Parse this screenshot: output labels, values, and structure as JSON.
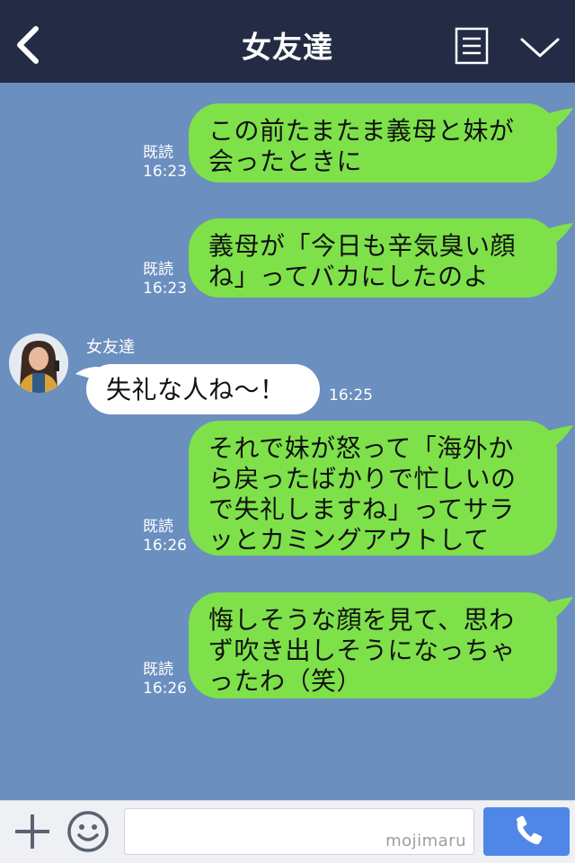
{
  "header": {
    "title": "女友達"
  },
  "messages": [
    {
      "from": "me",
      "lines": [
        "この前たまたま義母と妹が",
        "会ったときに"
      ],
      "status": "既読",
      "time": "16:23"
    },
    {
      "from": "me",
      "lines": [
        "義母が「今日も辛気臭い顔",
        "ね」ってバカにしたのよ"
      ],
      "status": "既読",
      "time": "16:23"
    },
    {
      "from": "friend",
      "sender": "女友達",
      "lines": [
        "失礼な人ね〜！"
      ],
      "time": "16:25"
    },
    {
      "from": "me",
      "lines": [
        "それで妹が怒って「海外か",
        "ら戻ったばかりで忙しいの",
        "で失礼しますね」ってサラ",
        "ッとカミングアウトして"
      ],
      "status": "既読",
      "time": "16:26"
    },
    {
      "from": "me",
      "lines": [
        "悔しそうな顔を見て、思わ",
        "ず吹き出しそうになっちゃ",
        "ったわ（笑）"
      ],
      "status": "既読",
      "time": "16:26"
    }
  ],
  "composer": {
    "watermark": "mojimaru"
  },
  "icons": {
    "back": "chevron-left-icon",
    "menu": "menu-icon",
    "collapse": "chevron-down-icon",
    "plus": "plus-icon",
    "emoji": "smile-icon",
    "call": "phone-icon"
  },
  "colors": {
    "header_bg": "#232c44",
    "chat_bg": "#6b8fbe",
    "my_bubble": "#7ee14a",
    "friend_bubble": "#ffffff",
    "call_button": "#4f87e8"
  }
}
